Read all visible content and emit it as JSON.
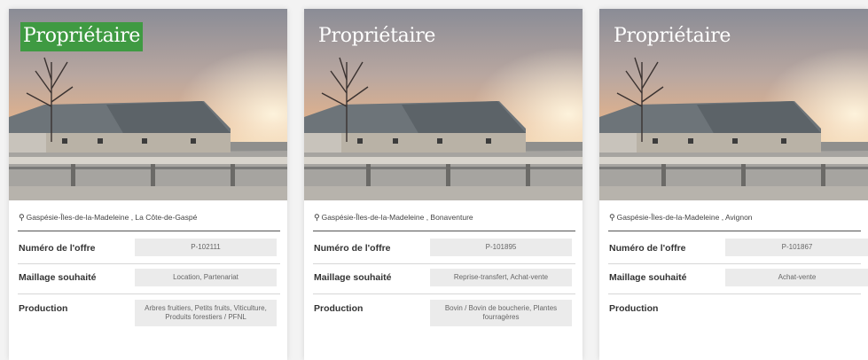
{
  "listings": [
    {
      "badge": "Propriétaire",
      "location": "Gaspésie-Îles-de-la-Madeleine , La Côte-de-Gaspé",
      "rows": [
        {
          "label": "Numéro de l'offre",
          "value": "P-102111"
        },
        {
          "label": "Maillage souhaité",
          "value": "Location, Partenariat"
        },
        {
          "label": "Production",
          "value": "Arbres fruitiers, Petits fruits, Viticulture, Produits forestiers / PFNL"
        }
      ]
    },
    {
      "badge": "Propriétaire",
      "location": "Gaspésie-Îles-de-la-Madeleine , Bonaventure",
      "rows": [
        {
          "label": "Numéro de l'offre",
          "value": "P-101895"
        },
        {
          "label": "Maillage souhaité",
          "value": "Reprise-transfert, Achat-vente"
        },
        {
          "label": "Production",
          "value": "Bovin / Bovin de boucherie, Plantes fourragères"
        }
      ]
    },
    {
      "badge": "Propriétaire",
      "location": "Gaspésie-Îles-de-la-Madeleine , Avignon",
      "rows": [
        {
          "label": "Numéro de l'offre",
          "value": "P-101867"
        },
        {
          "label": "Maillage souhaité",
          "value": "Achat-vente"
        },
        {
          "label": "Production",
          "value": ""
        }
      ]
    }
  ],
  "icons": {
    "location": "map-pin-icon"
  },
  "colors": {
    "badge_active": "#3f9a42",
    "card_bg": "#ffffff",
    "value_bg": "#ebebeb"
  }
}
